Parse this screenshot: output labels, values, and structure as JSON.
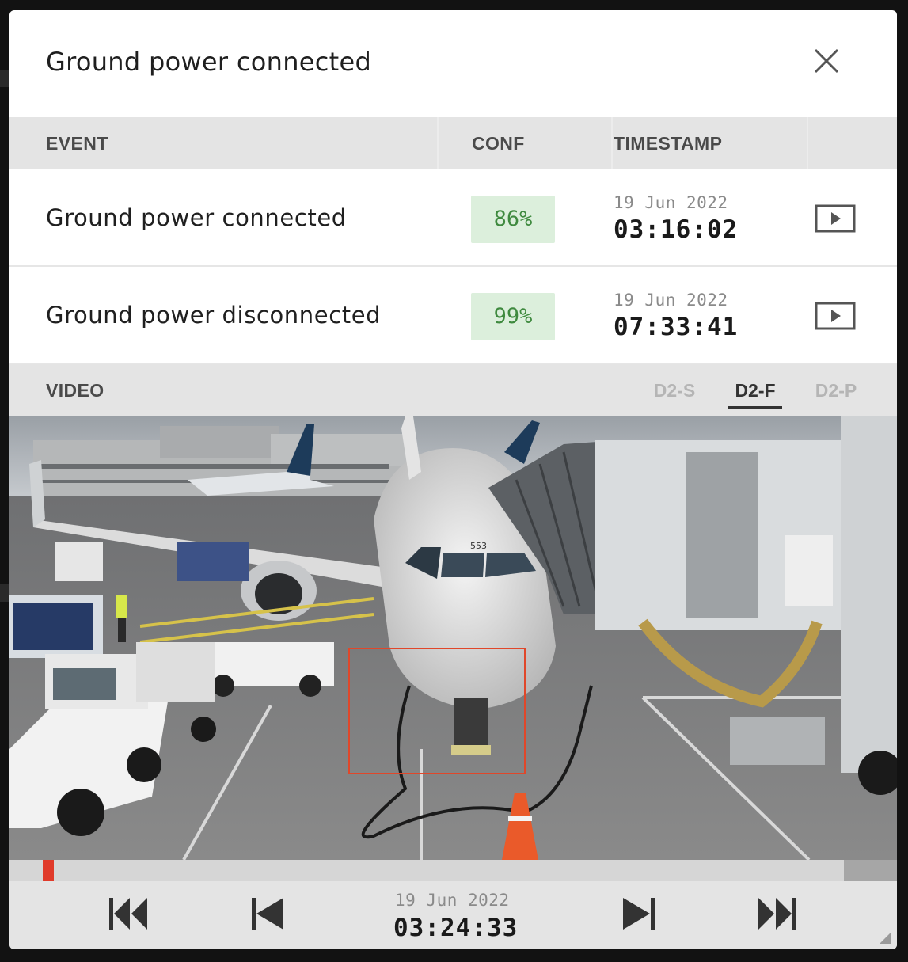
{
  "modal": {
    "title": "Ground power connected"
  },
  "table": {
    "headers": {
      "event": "EVENT",
      "conf": "CONF",
      "timestamp": "TIMESTAMP"
    },
    "rows": [
      {
        "event": "Ground power connected",
        "conf": "86%",
        "date": "19 Jun 2022",
        "time": "03:16:02"
      },
      {
        "event": "Ground power disconnected",
        "conf": "99%",
        "date": "19 Jun 2022",
        "time": "07:33:41"
      }
    ]
  },
  "video": {
    "label": "VIDEO",
    "cameras": [
      {
        "label": "D2-S",
        "active": false
      },
      {
        "label": "D2-F",
        "active": true
      },
      {
        "label": "D2-P",
        "active": false
      }
    ],
    "aircraft_number": "553",
    "progress": 0.04
  },
  "playback": {
    "date": "19 Jun 2022",
    "time": "03:24:33",
    "buttons": [
      "skip-to-start",
      "previous-frame",
      "next-frame",
      "skip-to-end"
    ]
  },
  "colors": {
    "conf_badge_bg": "#dcefdc",
    "conf_badge_text": "#3f8a3f",
    "playhead": "#e03a2a",
    "detection_box": "#e0472a"
  },
  "icons": [
    "close-icon",
    "play-icon",
    "skip-to-start-icon",
    "previous-icon",
    "next-icon",
    "skip-to-end-icon",
    "resize-grip-icon"
  ]
}
